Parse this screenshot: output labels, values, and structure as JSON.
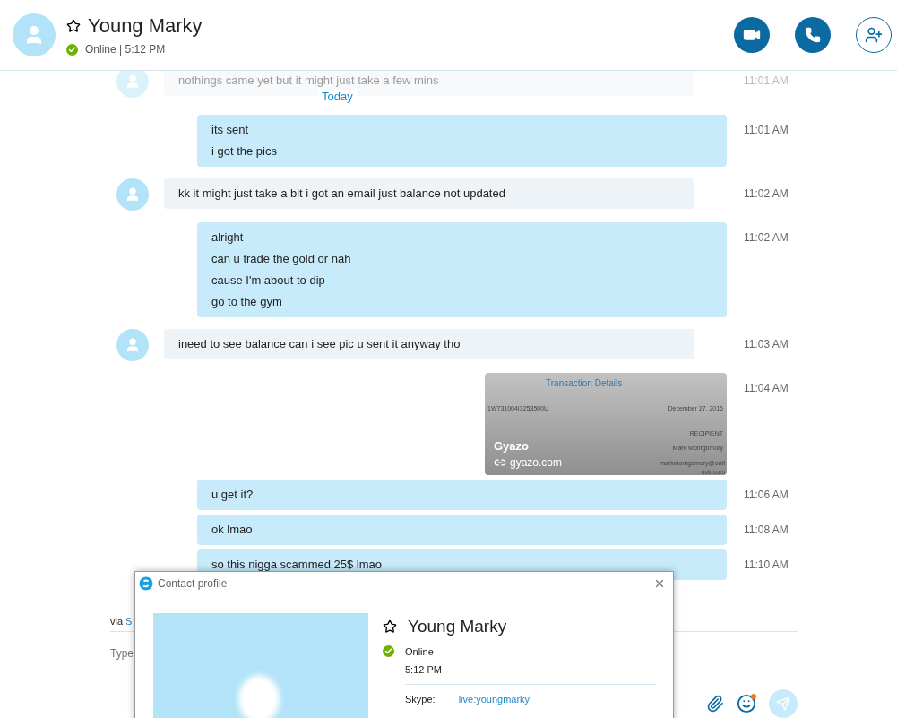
{
  "header": {
    "name": "Young Marky",
    "status": "Online | 5:12 PM",
    "online": true
  },
  "day_label": "Today",
  "messages": [
    {
      "kind": "incoming",
      "faded": true,
      "lines": [
        "nothings came yet but it might just take a few mins"
      ],
      "time": "11:01 AM"
    },
    {
      "kind": "outgoing",
      "faded": false,
      "lines": [
        "its sent",
        "i got the pics"
      ],
      "time": "11:01 AM"
    },
    {
      "kind": "incoming",
      "faded": false,
      "lines": [
        "kk it might just take a bit i got an email just balance not updated"
      ],
      "time": "11:02 AM"
    },
    {
      "kind": "outgoing",
      "faded": false,
      "lines": [
        "alright",
        "can u trade the gold or nah",
        "cause I'm about to dip",
        "go to the gym"
      ],
      "time": "11:02 AM"
    },
    {
      "kind": "incoming",
      "faded": false,
      "lines": [
        "ineed to see balance can i see pic u sent it anyway tho"
      ],
      "time": "11:03 AM"
    },
    {
      "faded": false,
      "preview": {
        "heading": "Transaction Details",
        "id": "1W731004I3253500U",
        "date": "December 27, 2016",
        "recipient_label": "RECIPIENT",
        "recipient": "Mark Montgomory",
        "email": [
          "markmontgomory@outl",
          "ook.com"
        ]
      },
      "site": "Gyazo",
      "link": "gyazo.com",
      "time": "11:04 AM"
    },
    {
      "kind": "outgoing",
      "faded": false,
      "lines": [
        "u get it?"
      ],
      "time": "11:06 AM"
    },
    {
      "kind": "outgoing",
      "faded": false,
      "lines": [
        "ok lmao"
      ],
      "time": "11:08 AM"
    },
    {
      "kind": "outgoing",
      "faded": false,
      "lines": [
        "so this nigga scammed 25$ lmao"
      ],
      "time": "11:10 AM"
    }
  ],
  "composer": {
    "via": "via",
    "via_link": "S",
    "placeholder": "Type"
  },
  "profile_dialog": {
    "title": "Contact profile",
    "name": "Young Marky",
    "status": "Online",
    "online": true,
    "time": "5:12 PM",
    "fields": [
      {
        "label": "Skype:",
        "value": "live:youngmarky"
      }
    ]
  }
}
